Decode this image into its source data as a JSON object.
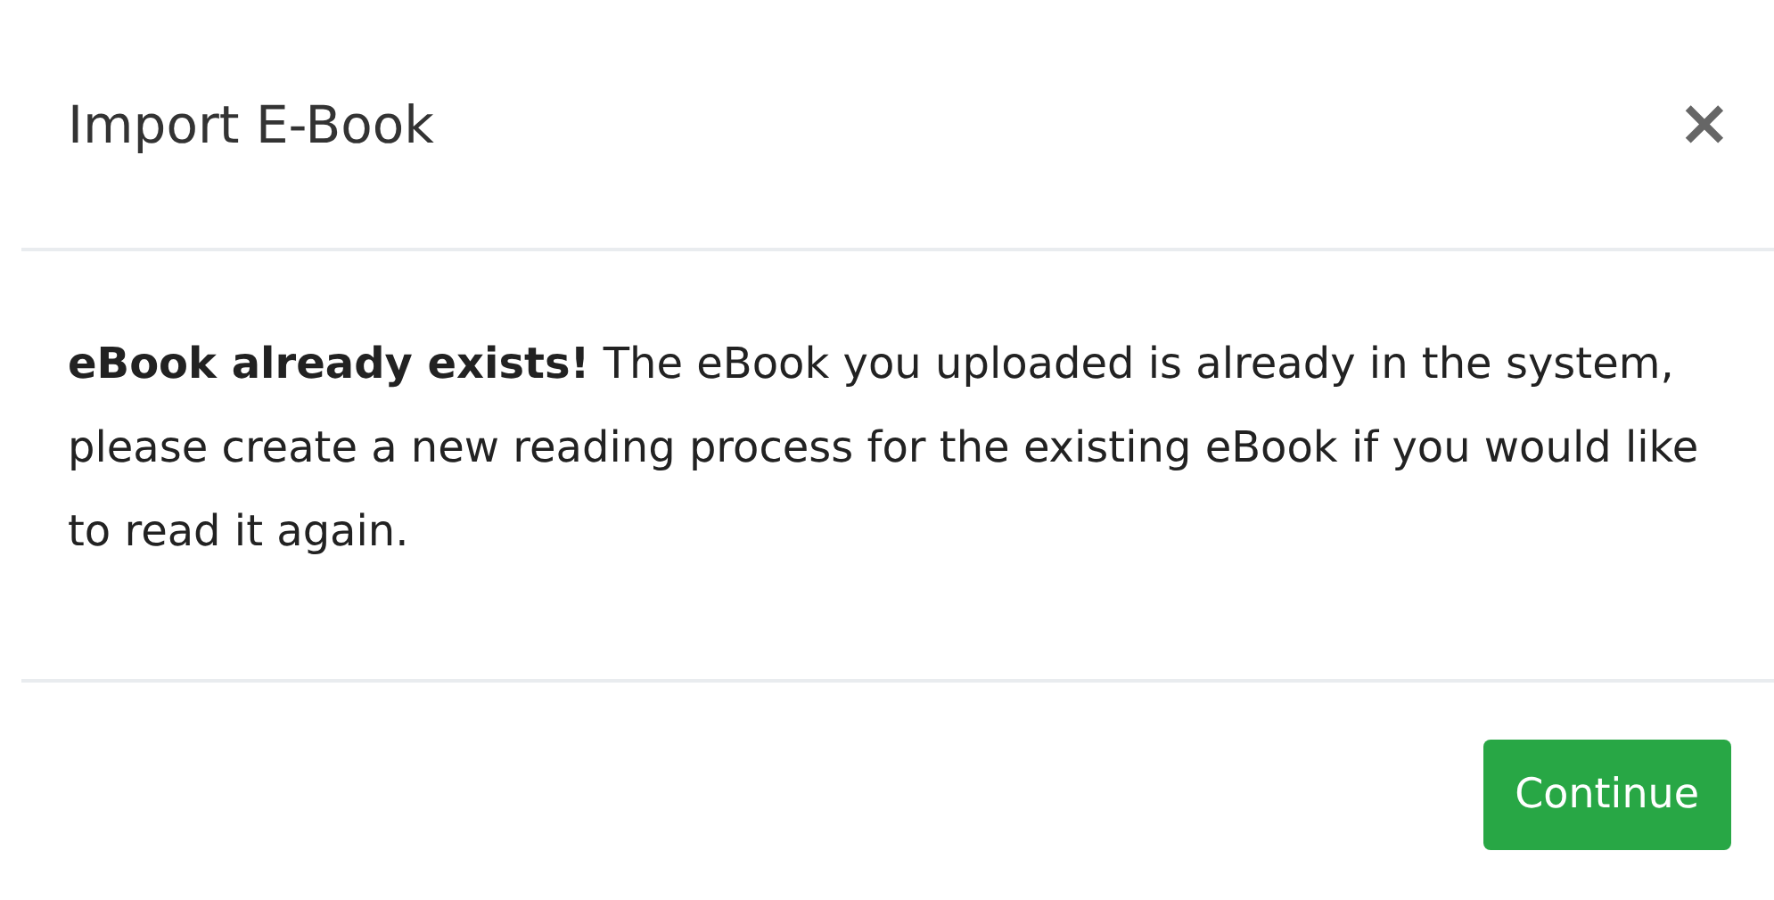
{
  "dialog": {
    "title": "Import E-Book",
    "close": "×",
    "message": "**eBook already exists!** The eBook you uploaded is already in the system, please create a new reading process for the existing eBook if you would like to read it again.",
    "buttons": [
      {
        "label": "Continue",
        "kind": "primary"
      }
    ]
  }
}
